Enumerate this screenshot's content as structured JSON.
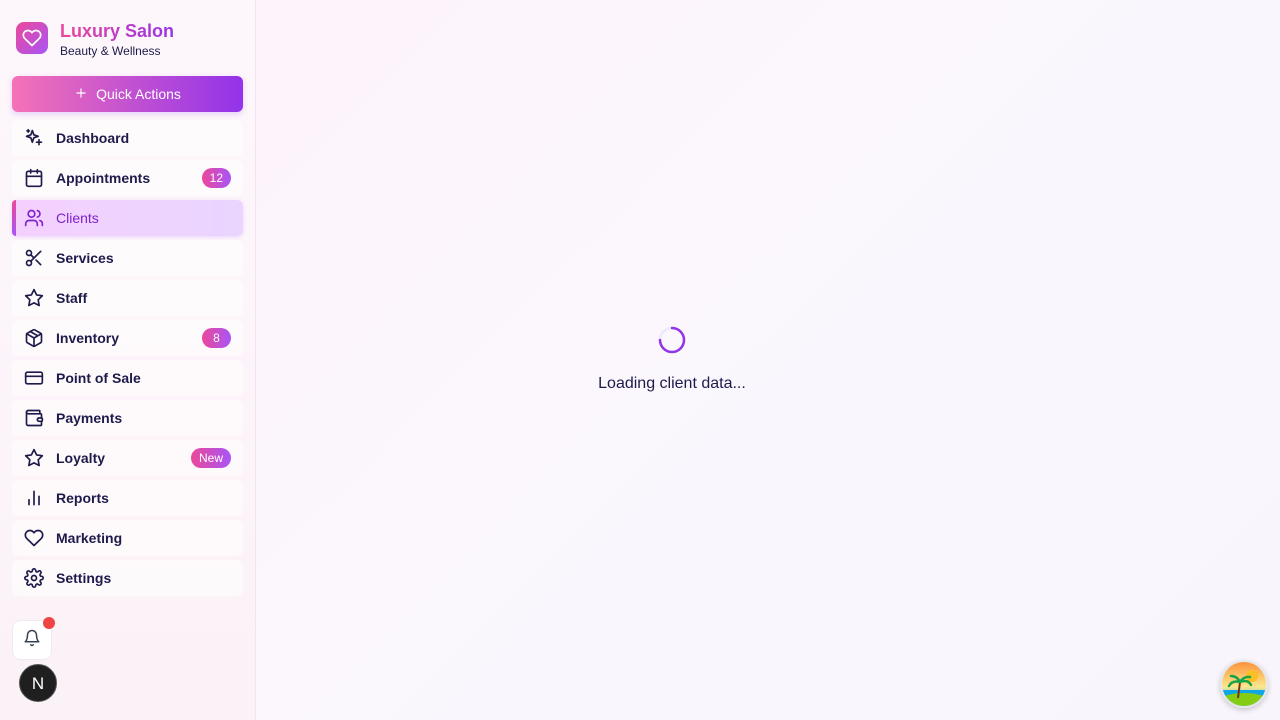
{
  "brand": {
    "name": "Luxury Salon",
    "subtitle": "Beauty & Wellness",
    "icon": "heart-icon"
  },
  "quick_actions": {
    "label": "Quick Actions",
    "icon": "plus-icon"
  },
  "nav": {
    "active": "Clients",
    "items": [
      {
        "label": "Dashboard",
        "icon": "sparkles-icon"
      },
      {
        "label": "Appointments",
        "icon": "calendar-icon",
        "badge": "12"
      },
      {
        "label": "Clients",
        "icon": "users-icon"
      },
      {
        "label": "Services",
        "icon": "scissors-icon"
      },
      {
        "label": "Staff",
        "icon": "star-icon"
      },
      {
        "label": "Inventory",
        "icon": "package-icon",
        "badge": "8"
      },
      {
        "label": "Point of Sale",
        "icon": "credit-card-icon"
      },
      {
        "label": "Payments",
        "icon": "wallet-icon"
      },
      {
        "label": "Loyalty",
        "icon": "star-icon",
        "badge": "New"
      },
      {
        "label": "Reports",
        "icon": "bar-chart-icon"
      },
      {
        "label": "Marketing",
        "icon": "heart-icon"
      },
      {
        "label": "Settings",
        "icon": "gear-icon"
      }
    ]
  },
  "footer": {
    "notification_icon": "bell-icon",
    "avatar_letter": "N"
  },
  "main": {
    "loading_text": "Loading client data..."
  },
  "colors": {
    "accent_pink": "#ec4899",
    "accent_purple": "#9333ea",
    "text": "#1e1b4b",
    "notification": "#ef4444"
  }
}
